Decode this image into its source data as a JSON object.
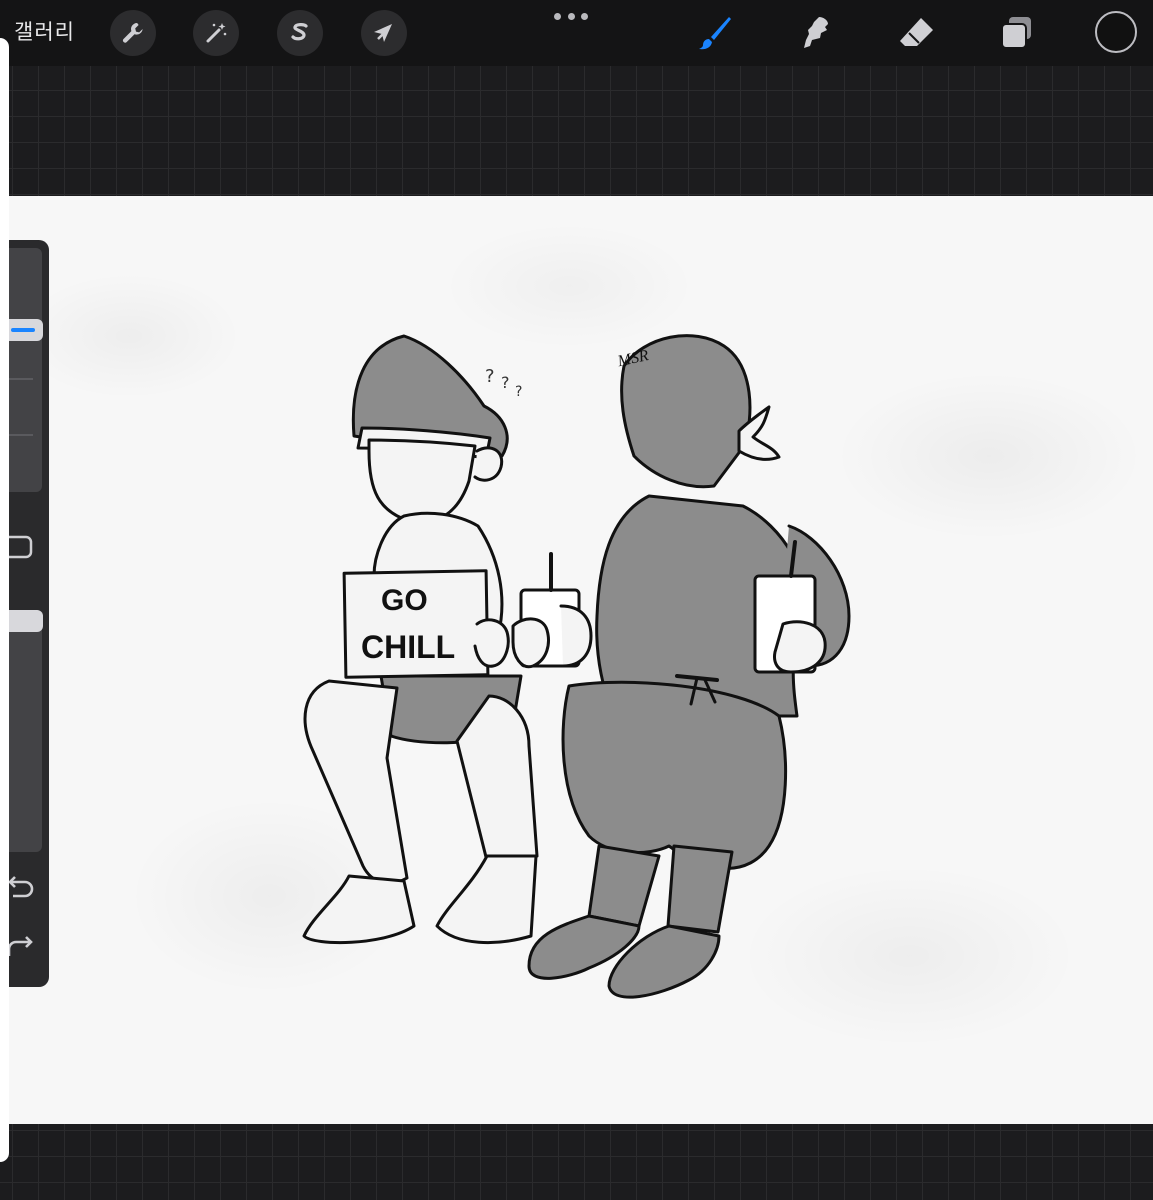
{
  "toolbar": {
    "gallery_label": "갤러리",
    "actions_icon": "wrench-icon",
    "adjustments_icon": "magic-wand-icon",
    "selection_icon": "selection-s-icon",
    "transform_icon": "arrow-cursor-icon",
    "brush_icon": "brush-icon",
    "smudge_icon": "smudge-icon",
    "eraser_icon": "eraser-icon",
    "layers_icon": "layers-icon",
    "active_tool": "brush",
    "accent_color": "#1a84ff",
    "current_color": "#111111"
  },
  "sidebar": {
    "brush_size": 0.32,
    "opacity": 0.02,
    "modify_icon": "square-icon",
    "undo_icon": "undo-icon",
    "redo_icon": "redo-icon"
  },
  "artwork": {
    "sign_line1": "GO",
    "sign_line2": "CHILL",
    "signature": "MSR",
    "mark": "?"
  },
  "colors": {
    "topbar": "#141415",
    "background": "#1c1c1e",
    "canvas": "#f7f7f7",
    "sidebar": "#2a2a2c"
  }
}
